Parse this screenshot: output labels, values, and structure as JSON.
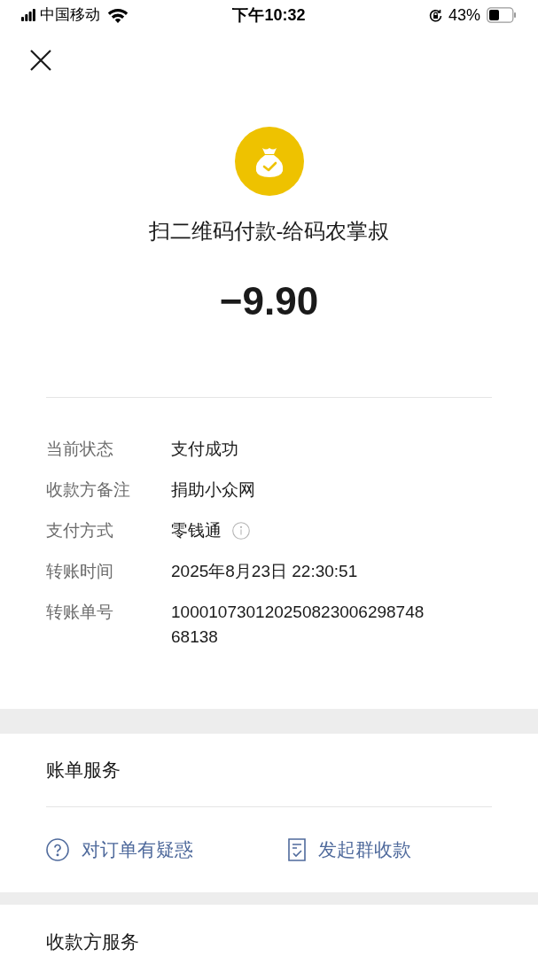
{
  "status_bar": {
    "carrier": "中国移动",
    "time": "下午10:32",
    "battery": "43%"
  },
  "payment": {
    "title": "扫二维码付款-给码农掌叔",
    "amount": "−9.90"
  },
  "details": [
    {
      "label": "当前状态",
      "value": "支付成功",
      "info": false
    },
    {
      "label": "收款方备注",
      "value": "捐助小众网",
      "info": false
    },
    {
      "label": "支付方式",
      "value": "零钱通",
      "info": true
    },
    {
      "label": "转账时间",
      "value": "2025年8月23日 22:30:51",
      "info": false
    },
    {
      "label": "转账单号",
      "value": "100010730120250823006298748 68138",
      "info": false
    }
  ],
  "bill_services": {
    "title": "账单服务",
    "actions": [
      {
        "kind": "question",
        "label": "对订单有疑惑"
      },
      {
        "kind": "document",
        "label": "发起群收款"
      }
    ]
  },
  "payee_services": {
    "title": "收款方服务"
  }
}
